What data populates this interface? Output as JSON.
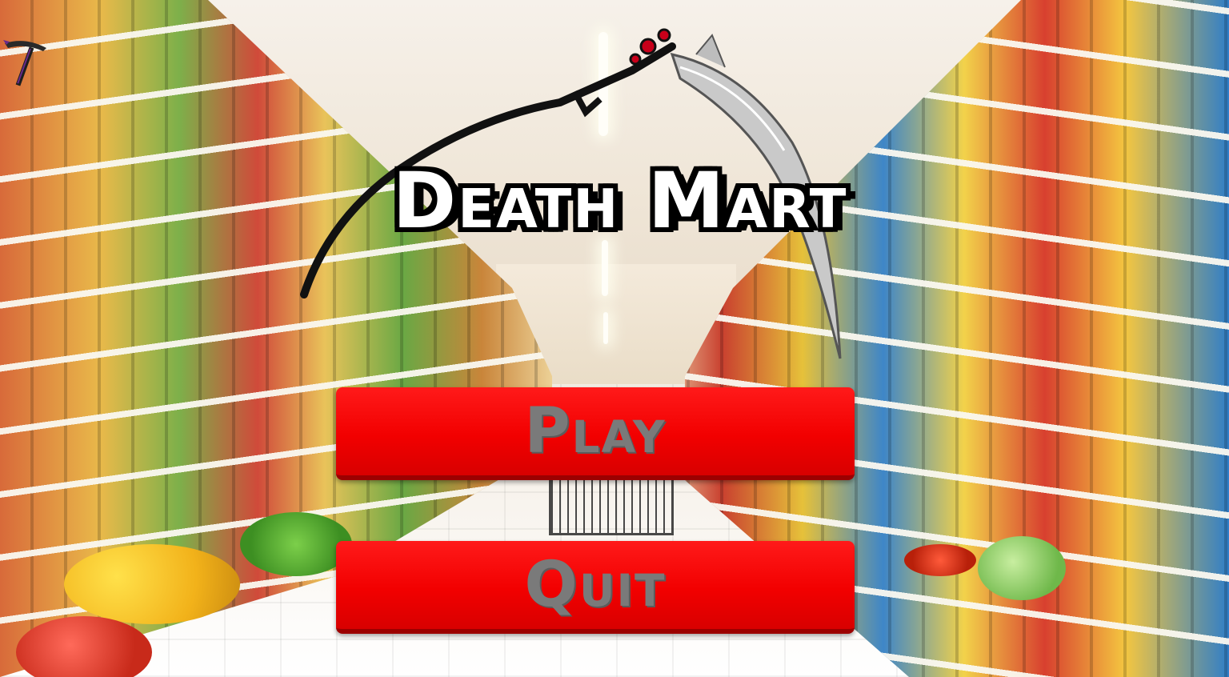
{
  "title": "Death Mart",
  "menu": {
    "play_label": "Play",
    "quit_label": "Quit"
  },
  "icons": {
    "corner": "pickaxe-icon",
    "title_decoration": "scythe-icon"
  },
  "colors": {
    "button": "#f20000",
    "button_text": "#7a7a7a",
    "title_fill": "#ffffff",
    "title_outline": "#000000"
  }
}
